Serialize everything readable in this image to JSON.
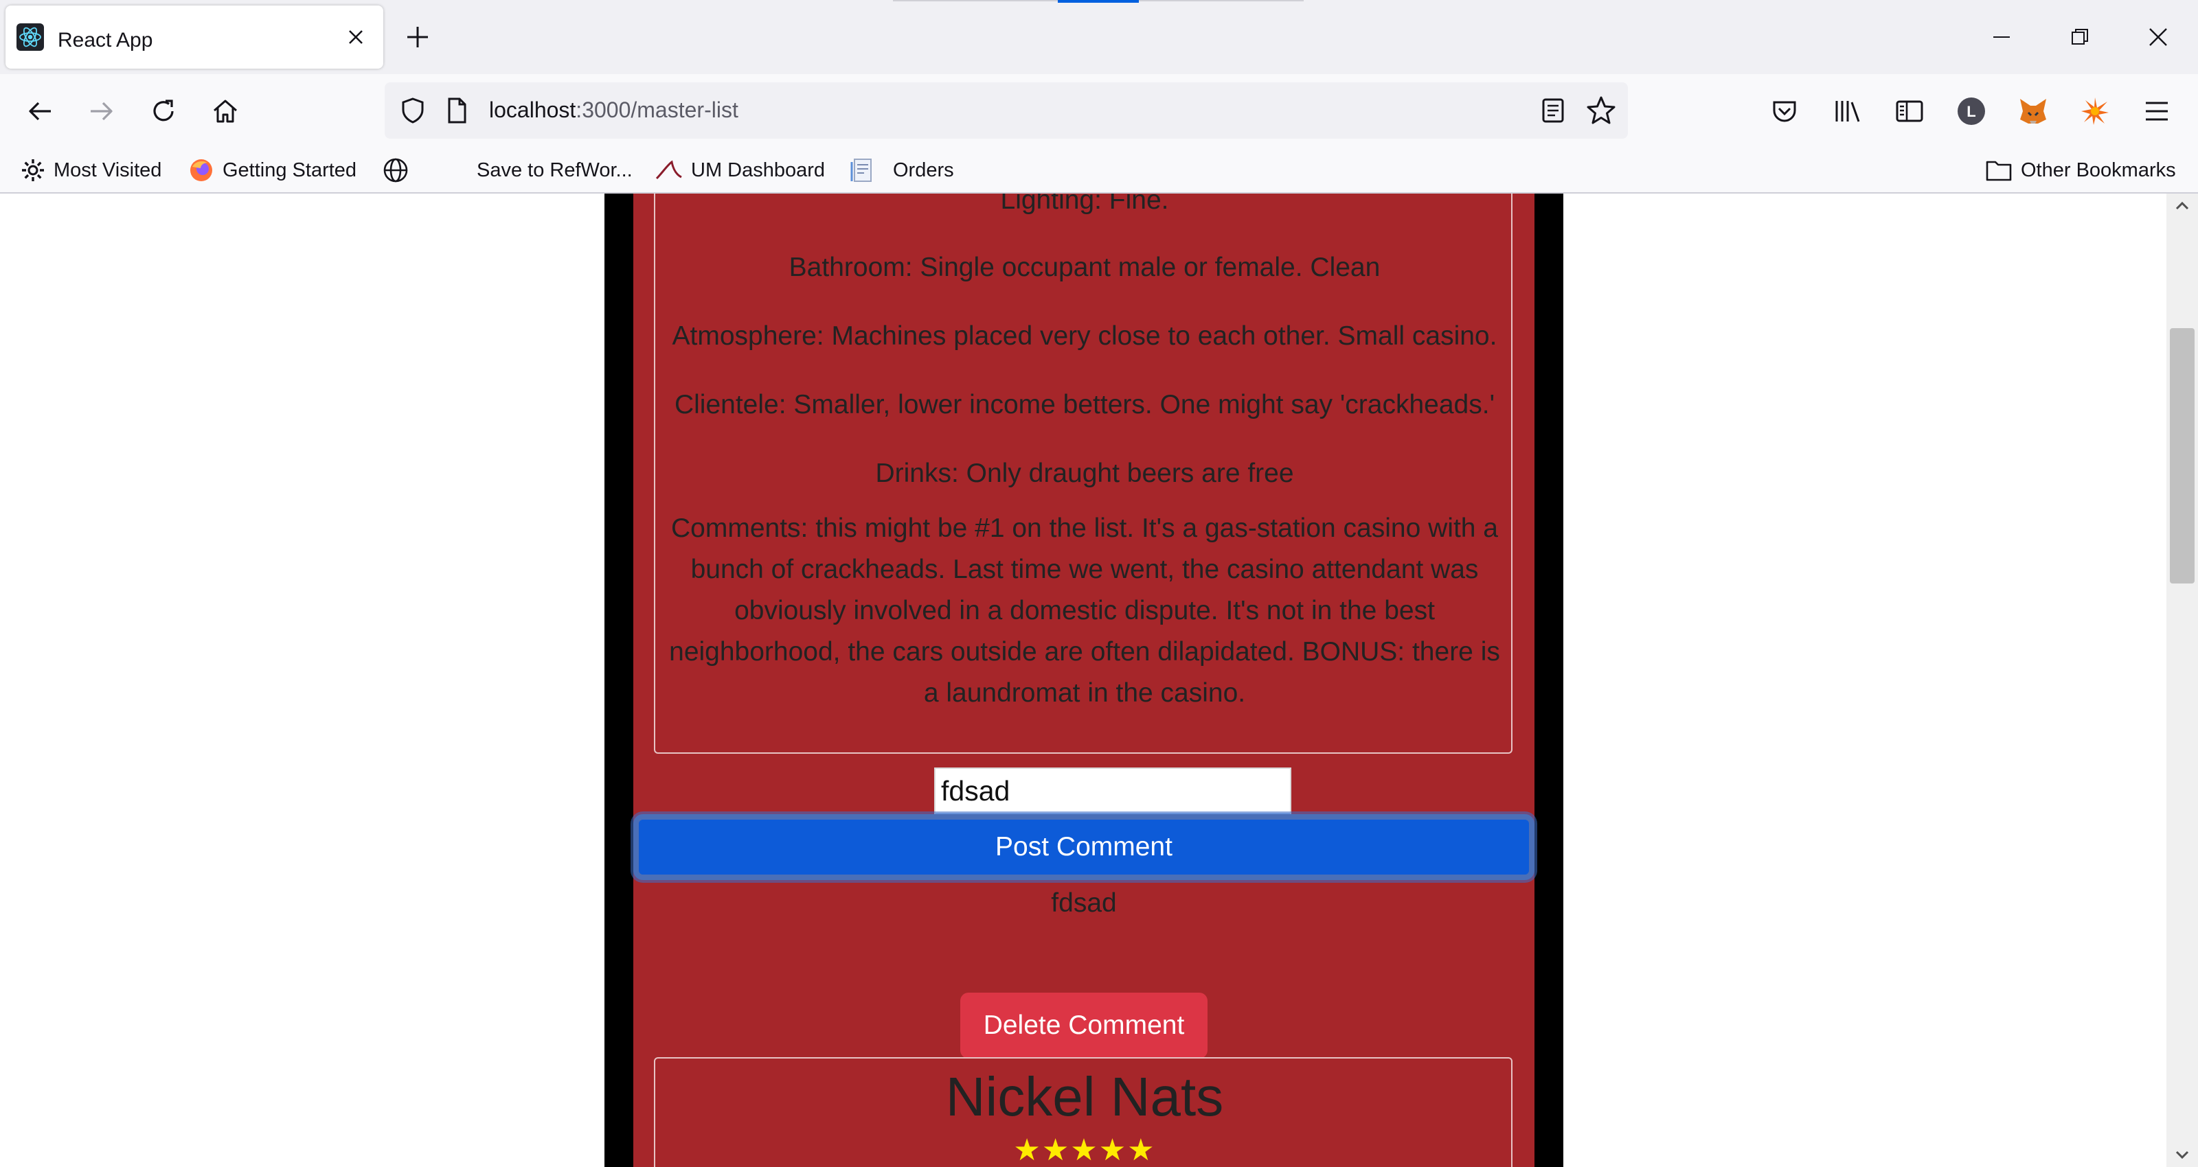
{
  "browser": {
    "tab_title": "React App",
    "url_host": "localhost",
    "url_path": ":3000/master-list",
    "bookmarks": {
      "most_visited": "Most Visited",
      "getting_started": "Getting Started",
      "save_refworks": "Save to RefWor...",
      "um_dashboard": "UM Dashboard",
      "orders": "Orders",
      "other_bookmarks": "Other Bookmarks"
    },
    "profile_initial": "L"
  },
  "page": {
    "card1": {
      "lighting": "Lighting: Fine.",
      "bathroom": "Bathroom: Single occupant male or female. Clean",
      "atmosphere": "Atmosphere: Machines placed very close to each other. Small casino.",
      "clientele": "Clientele: Smaller, lower income betters. One might say 'crackheads.'",
      "drinks": "Drinks: Only draught beers are free",
      "comments": "Comments: this might be #1 on the list. It's a gas-station casino with a bunch of crackheads. Last time we went, the casino attendant was obviously involved in a domestic dispute. It's not in the best neighborhood, the cars outside are often dilapidated. BONUS: there is a laundromat in the casino."
    },
    "comment_input_value": "fdsad",
    "post_button_label": "Post Comment",
    "posted_comment": "fdsad",
    "delete_button_label": "Delete Comment",
    "card2": {
      "title": "Nickel Nats",
      "stars": "★★★★★"
    }
  },
  "colors": {
    "panel_red": "#a6262a",
    "post_blue": "#0d5bd8",
    "delete_red": "#dc3545",
    "star_yellow": "#ffeb00"
  }
}
